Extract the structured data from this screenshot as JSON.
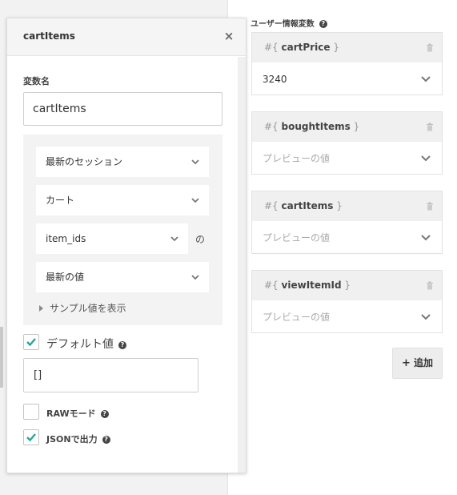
{
  "panel": {
    "title": "cartItems",
    "close_glyph": "×",
    "varname_label": "変数名",
    "varname_value": "cartItems",
    "selects": [
      {
        "value": "最新のセッション"
      },
      {
        "value": "カート"
      },
      {
        "value": "item_ids"
      },
      {
        "value": "最新の値"
      }
    ],
    "no_label": "の",
    "sample_toggle": "サンプル値を表示",
    "default_label": "デフォルト値",
    "default_checked": true,
    "default_value": "[]",
    "raw_label": "RAWモード",
    "raw_checked": false,
    "json_label": "JSONで出力",
    "json_checked": true,
    "help_glyph": "?"
  },
  "right": {
    "title": "ユーザー情報変数",
    "variables": [
      {
        "prefix": "#{",
        "name": "cartPrice",
        "suffix": "}",
        "value": "3240",
        "is_placeholder": false
      },
      {
        "prefix": "#{",
        "name": "boughtItems",
        "suffix": "}",
        "value": "プレビューの値",
        "is_placeholder": true
      },
      {
        "prefix": "#{",
        "name": "cartItems",
        "suffix": "}",
        "value": "プレビューの値",
        "is_placeholder": true
      },
      {
        "prefix": "#{",
        "name": "viewItemId",
        "suffix": "}",
        "value": "プレビューの値",
        "is_placeholder": true
      }
    ],
    "add_button": {
      "icon": "plus-icon",
      "glyph": "+",
      "label": "追加"
    }
  },
  "colors": {
    "accent_check": "#26a69a",
    "panel_bg": "#ffffff",
    "page_bg": "#f2f2f2"
  }
}
